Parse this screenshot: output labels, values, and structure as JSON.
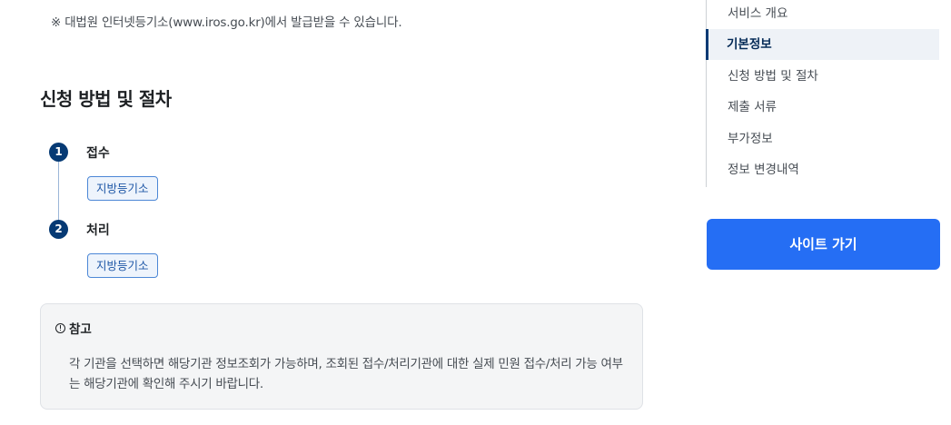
{
  "notice": "※ 대법원 인터넷등기소(www.iros.go.kr)에서 발급받을 수 있습니다.",
  "section_title": "신청 방법 및 절차",
  "steps": [
    {
      "num": "1",
      "title": "접수",
      "tag": "지방등기소"
    },
    {
      "num": "2",
      "title": "처리",
      "tag": "지방등기소"
    }
  ],
  "note": {
    "label": "참고",
    "body": "각 기관을 선택하면 해당기관 정보조회가 가능하며, 조회된 접수/처리기관에 대한 실제 민원 접수/처리 가능 여부는 해당기관에 확인해 주시기 바랍니다."
  },
  "side_nav": {
    "items": [
      {
        "label": "서비스 개요"
      },
      {
        "label": "기본정보",
        "active": true
      },
      {
        "label": "신청 방법 및 절차"
      },
      {
        "label": "제출 서류"
      },
      {
        "label": "부가정보"
      },
      {
        "label": "정보 변경내역"
      }
    ]
  },
  "site_button": "사이트 가기",
  "colors": {
    "primary": "#256ef4",
    "step_circle": "#063a74",
    "tag_border": "#4c87d6",
    "active_nav_bg": "#eef2f7"
  }
}
